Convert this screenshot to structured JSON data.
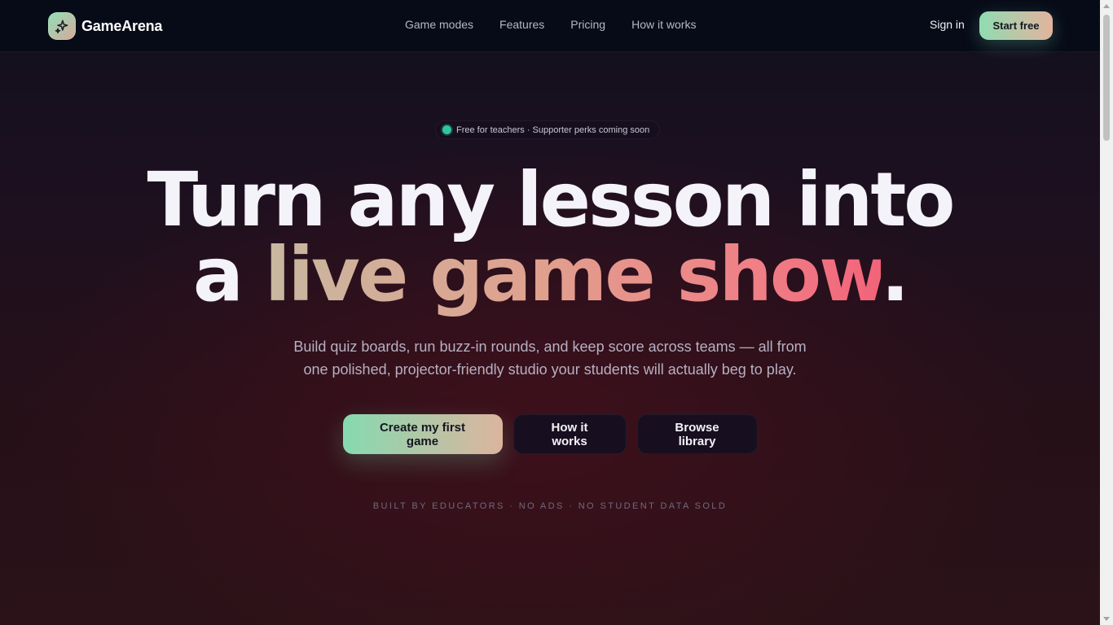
{
  "nav": {
    "brand": "GameArena",
    "links": [
      "Game modes",
      "Features",
      "Pricing",
      "How it works"
    ],
    "sign_in": "Sign in",
    "start_free": "Start free"
  },
  "hero": {
    "badge": "Free for teachers · Supporter perks coming soon",
    "headline_line1": "Turn any lesson into",
    "headline_line2_pre": "a ",
    "headline_line2_highlight": "live game show",
    "headline_line2_post": ".",
    "subtitle_line1": "Build quiz boards, run buzz-in rounds, and keep score across teams — all from",
    "subtitle_line2": "one polished, projector-friendly studio your students will actually beg to play.",
    "cta_primary": "Create my first game",
    "cta_secondary": "How it works",
    "cta_tertiary": "Browse library",
    "tagline": "BUILT BY EDUCATORS · NO ADS · NO STUDENT DATA SOLD"
  },
  "colors": {
    "accent_green": "#8fdcb2",
    "accent_peach": "#e3b39e",
    "accent_pink": "#f2637a",
    "badge_dot": "#2ec79c"
  },
  "icons": {
    "logo": "sparkles-icon"
  }
}
